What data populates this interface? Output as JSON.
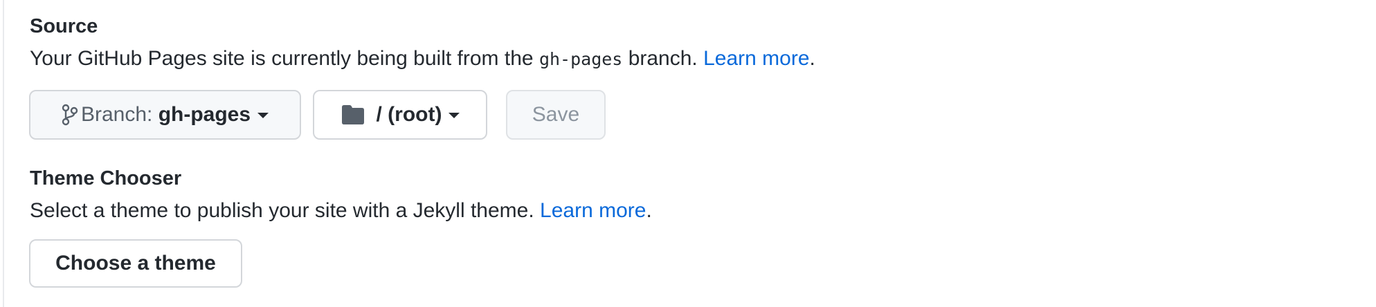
{
  "source": {
    "heading": "Source",
    "desc_prefix": "Your GitHub Pages site is currently being built from the ",
    "desc_code": "gh-pages",
    "desc_suffix": " branch. ",
    "learn_more": "Learn more",
    "period": "."
  },
  "branch_button": {
    "prefix": "Branch: ",
    "value": "gh-pages",
    "icon": "git-branch-icon"
  },
  "folder_button": {
    "value": "/ (root)",
    "icon": "folder-icon"
  },
  "save_button": {
    "label": "Save",
    "disabled": true
  },
  "theme": {
    "heading": "Theme Chooser",
    "desc": "Select a theme to publish your site with a Jekyll theme. ",
    "learn_more": "Learn more",
    "period": "."
  },
  "choose_theme_button": {
    "label": "Choose a theme"
  },
  "colors": {
    "link": "#0969da",
    "text": "#24292f",
    "button_bg": "#f6f8fa",
    "button_border": "#d3d6da",
    "disabled_text": "#8c959f"
  }
}
